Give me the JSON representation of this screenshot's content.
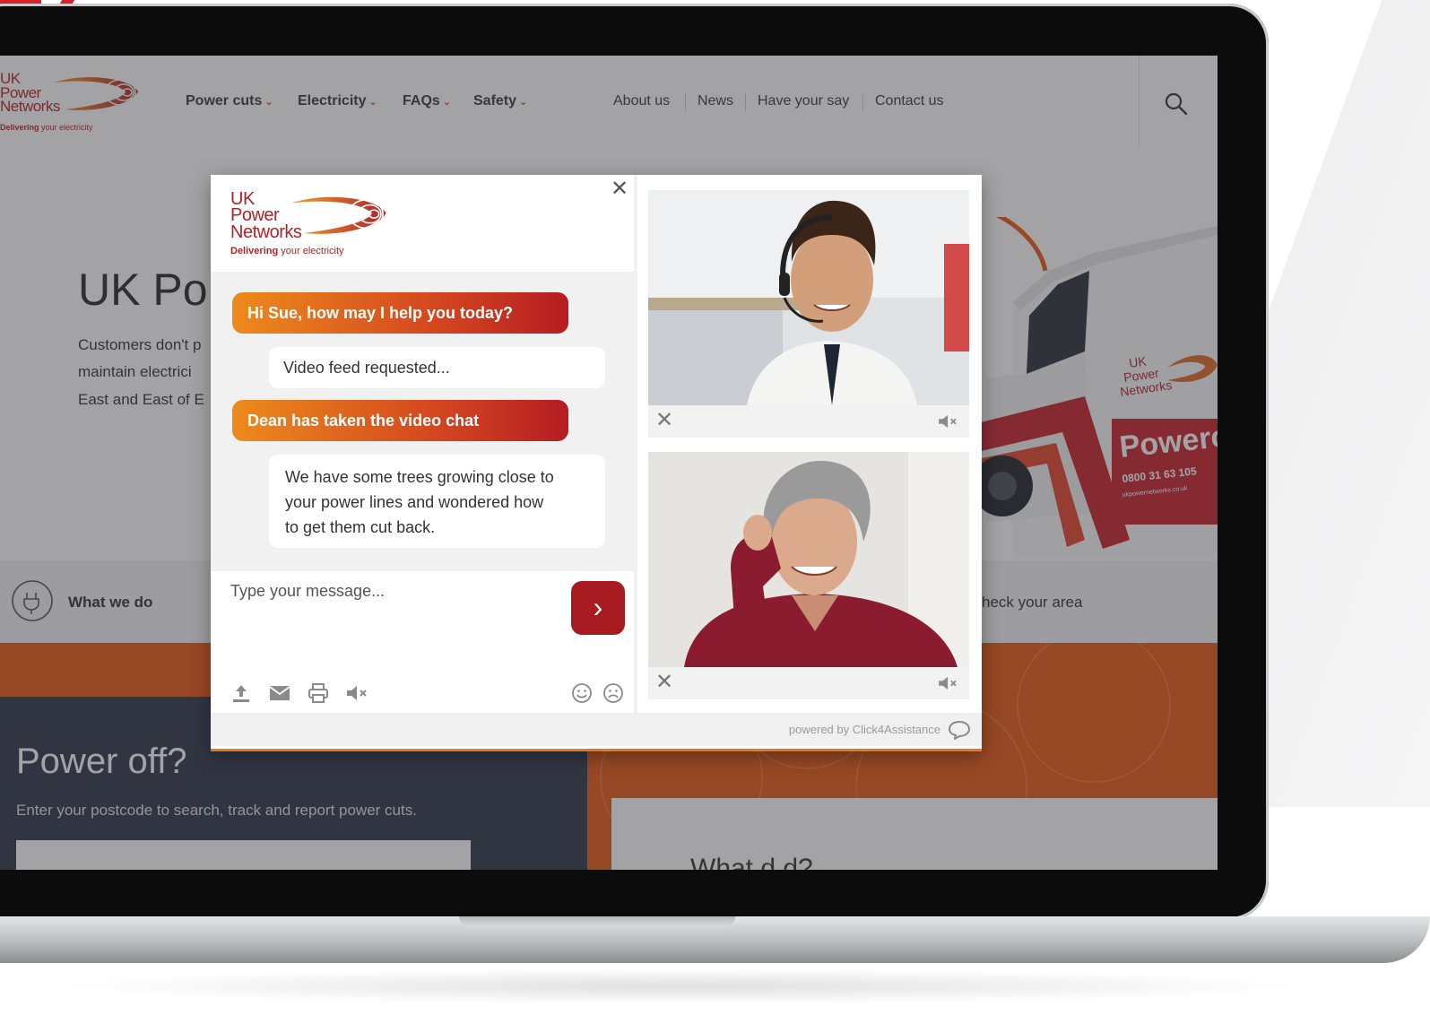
{
  "brand": {
    "logo_line1": "UK",
    "logo_line2": "Power",
    "logo_line3": "Networks",
    "tagline_bold": "Delivering",
    "tagline_rest": "your electricity"
  },
  "nav": {
    "dropdowns": [
      "Power cuts",
      "Electricity",
      "FAQs",
      "Safety"
    ],
    "links": [
      "About us",
      "News",
      "Have your say",
      "Contact us"
    ]
  },
  "hero": {
    "title": "UK Po",
    "lines": [
      "Customers don't p",
      "maintain electrici",
      "East and East of E"
    ]
  },
  "van": {
    "brand_line1": "UK",
    "brand_line2": "Power",
    "brand_line3": "Networks",
    "sign": "Powercut",
    "phone": "0800 31 63 105",
    "url": "ukpowernetworks.co.uk"
  },
  "features": {
    "what_we_do": "What we do",
    "check_area": "heck your area"
  },
  "power_off": {
    "title": "Power off?",
    "subtitle": "Enter your postcode to search, track and report power cuts.",
    "card_peek": "What d          d?"
  },
  "chat": {
    "messages": [
      {
        "from": "agent",
        "text": "Hi Sue, how may I help you today?"
      },
      {
        "from": "user",
        "text": "Video feed requested..."
      },
      {
        "from": "agent",
        "text": "Dean has taken the video chat"
      },
      {
        "from": "user",
        "lines": [
          "We have some trees growing close to",
          "your power lines and wondered how",
          "to get them cut back."
        ]
      }
    ],
    "input_placeholder": "Type your message...",
    "powered_by": "powered by Click4Assistance"
  },
  "colors": {
    "brand_red": "#b0222a",
    "accent_orange": "#e9570f",
    "send_button": "#a81c21",
    "dark_panel": "#2d3546"
  }
}
